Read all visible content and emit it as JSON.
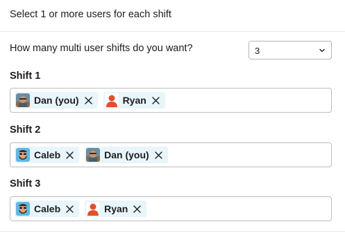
{
  "intro_text": "Select 1 or more users for each shift",
  "question": {
    "label": "How many multi user shifts do you want?",
    "selected_value": "3"
  },
  "shifts": [
    {
      "label": "Shift 1",
      "users": [
        {
          "name": "Dan (you)",
          "avatar": "photo-avatar"
        },
        {
          "name": "Ryan",
          "avatar": "default-avatar"
        }
      ]
    },
    {
      "label": "Shift 2",
      "users": [
        {
          "name": "Caleb",
          "avatar": "cartoon-avatar"
        },
        {
          "name": "Dan (you)",
          "avatar": "photo-avatar"
        }
      ]
    },
    {
      "label": "Shift 3",
      "users": [
        {
          "name": "Caleb",
          "avatar": "cartoon-avatar"
        },
        {
          "name": "Ryan",
          "avatar": "default-avatar"
        }
      ]
    }
  ],
  "colors": {
    "chip_background": "#e8f5fa",
    "default_avatar": "#e0512b",
    "cartoon_avatar_bg": "#5fb8e6"
  }
}
